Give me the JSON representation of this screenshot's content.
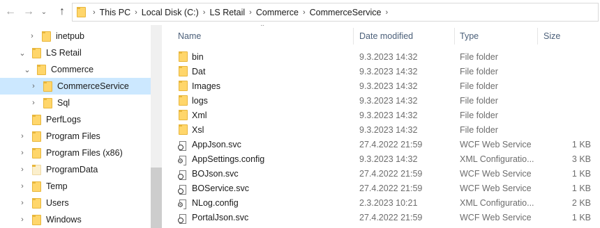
{
  "navigation": {
    "back_icon": "arrow-left-icon",
    "forward_icon": "arrow-right-icon",
    "history_icon": "chevron-down-icon",
    "up_icon": "arrow-up-icon",
    "breadcrumbs": [
      "This PC",
      "Local Disk (C:)",
      "LS Retail",
      "Commerce",
      "CommerceService"
    ]
  },
  "tree": {
    "items": [
      {
        "label": "inetpub",
        "expanded": false,
        "selected": false
      },
      {
        "label": "LS Retail",
        "expanded": true,
        "selected": false
      },
      {
        "label": "Commerce",
        "expanded": true,
        "selected": false
      },
      {
        "label": "CommerceService",
        "expanded": false,
        "selected": true
      },
      {
        "label": "Sql",
        "expanded": false,
        "selected": false
      },
      {
        "label": "PerfLogs",
        "expanded": false,
        "selected": false
      },
      {
        "label": "Program Files",
        "expanded": false,
        "selected": false
      },
      {
        "label": "Program Files (x86)",
        "expanded": false,
        "selected": false
      },
      {
        "label": "ProgramData",
        "expanded": false,
        "selected": false
      },
      {
        "label": "Temp",
        "expanded": false,
        "selected": false
      },
      {
        "label": "Users",
        "expanded": false,
        "selected": false
      },
      {
        "label": "Windows",
        "expanded": false,
        "selected": false
      }
    ]
  },
  "columns": {
    "name": "Name",
    "date_modified": "Date modified",
    "type": "Type",
    "size": "Size"
  },
  "files": [
    {
      "name": "bin",
      "date": "9.3.2023 14:32",
      "type": "File folder",
      "size": "",
      "icon": "folder-icon"
    },
    {
      "name": "Dat",
      "date": "9.3.2023 14:32",
      "type": "File folder",
      "size": "",
      "icon": "folder-icon"
    },
    {
      "name": "Images",
      "date": "9.3.2023 14:32",
      "type": "File folder",
      "size": "",
      "icon": "folder-icon"
    },
    {
      "name": "logs",
      "date": "9.3.2023 14:32",
      "type": "File folder",
      "size": "",
      "icon": "folder-icon"
    },
    {
      "name": "Xml",
      "date": "9.3.2023 14:32",
      "type": "File folder",
      "size": "",
      "icon": "folder-icon"
    },
    {
      "name": "Xsl",
      "date": "9.3.2023 14:32",
      "type": "File folder",
      "size": "",
      "icon": "folder-icon"
    },
    {
      "name": "AppJson.svc",
      "date": "27.4.2022 21:59",
      "type": "WCF Web Service",
      "size": "1 KB",
      "icon": "web-service-file-icon"
    },
    {
      "name": "AppSettings.config",
      "date": "9.3.2023 14:32",
      "type": "XML Configuratio...",
      "size": "3 KB",
      "icon": "config-file-icon"
    },
    {
      "name": "BOJson.svc",
      "date": "27.4.2022 21:59",
      "type": "WCF Web Service",
      "size": "1 KB",
      "icon": "web-service-file-icon"
    },
    {
      "name": "BOService.svc",
      "date": "27.4.2022 21:59",
      "type": "WCF Web Service",
      "size": "1 KB",
      "icon": "web-service-file-icon"
    },
    {
      "name": "NLog.config",
      "date": "2.3.2023 10:21",
      "type": "XML Configuratio...",
      "size": "2 KB",
      "icon": "config-file-icon"
    },
    {
      "name": "PortalJson.svc",
      "date": "27.4.2022 21:59",
      "type": "WCF Web Service",
      "size": "1 KB",
      "icon": "web-service-file-icon"
    }
  ],
  "colors": {
    "selection": "#cce8ff",
    "folder": "#ffd66b",
    "header_text": "#4c607a"
  }
}
